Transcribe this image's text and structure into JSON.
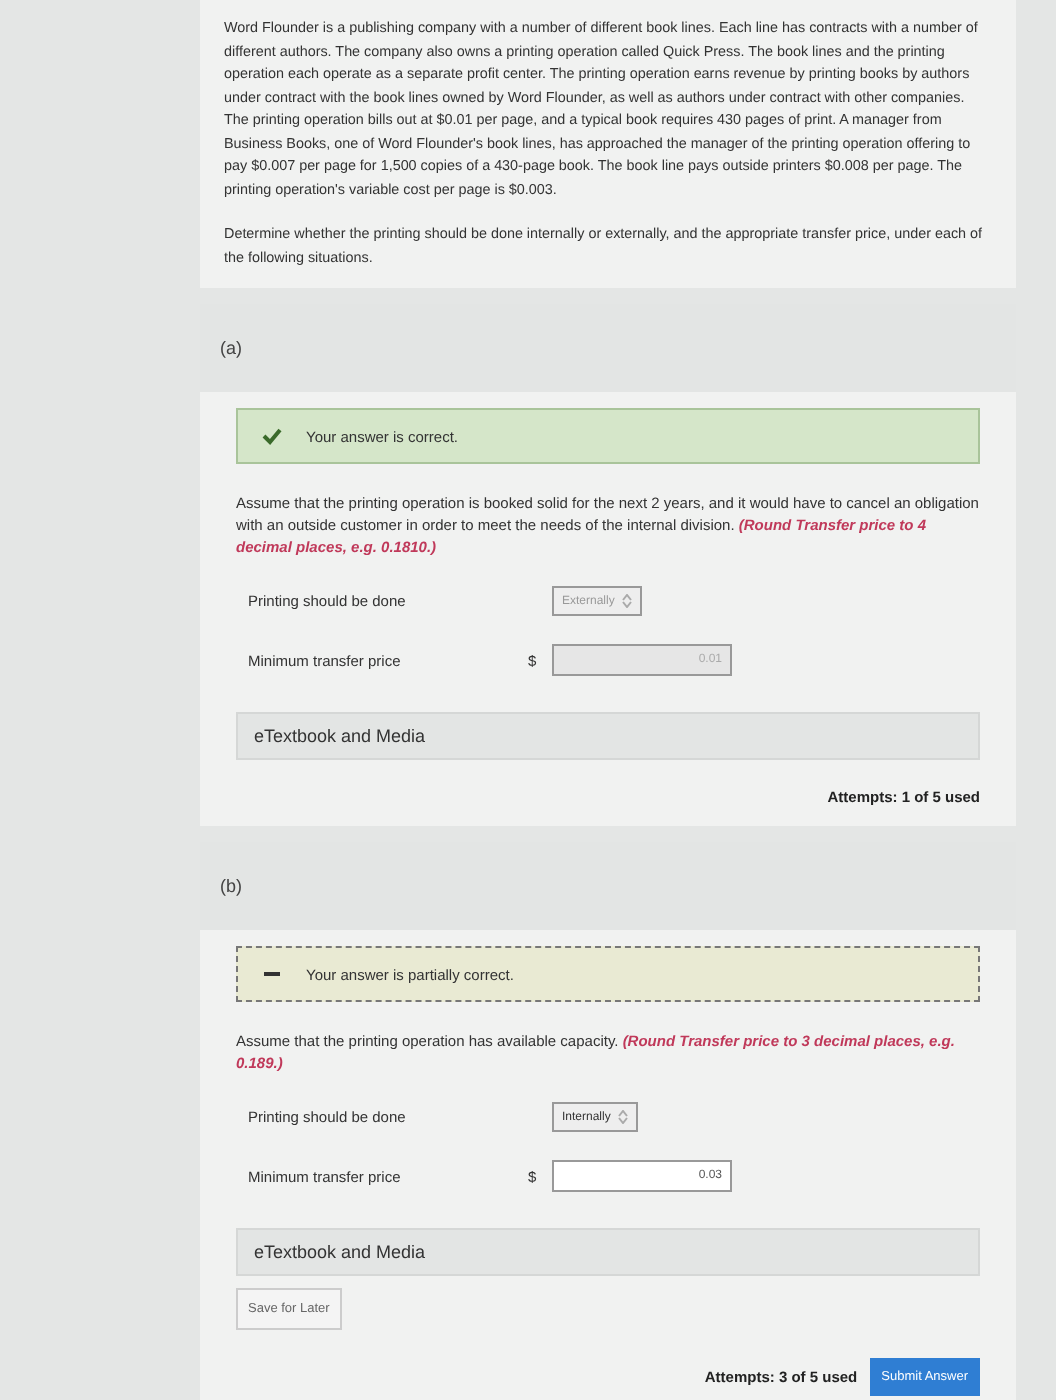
{
  "intro": [
    "Word Flounder is a publishing company with a number of different book lines. Each line has contracts with a number of different authors. The company also owns a printing operation called Quick Press. The book lines and the printing operation each operate as a separate profit center. The printing operation earns revenue by printing books by authors under contract with the book lines owned by Word Flounder, as well as authors under contract with other companies. The printing operation bills out at $0.01 per page, and a typical book requires 430 pages of print. A manager from Business Books, one of Word Flounder's book lines, has approached the manager of the printing operation offering to pay $0.007 per page for 1,500 copies of a 430-page book. The book line pays outside printers $0.008 per page. The printing operation's variable cost per page is $0.003.",
    "Determine whether the printing should be done internally or externally, and the appropriate transfer price, under each of the following situations."
  ],
  "parts": [
    {
      "label": "(a)",
      "disabled": true,
      "feedback": {
        "kind": "correct",
        "text": "Your answer is correct."
      },
      "question": "Assume that the printing operation is booked solid for the next 2 years, and it would have to cancel an obligation with an outside customer in order to meet the needs of the internal division. **(Round Transfer price to 4 decimal places, e.g. 0.1810.)**",
      "printing_label": "Printing should be done",
      "printing_select": "Externally",
      "price_label": "Minimum transfer price",
      "currency": "$",
      "price_value": "0.01",
      "media": "eTextbook and Media",
      "attempts": "Attempts: 1 of 5 used"
    },
    {
      "label": "(b)",
      "disabled": false,
      "feedback": {
        "kind": "partial",
        "text": "Your answer is partially correct."
      },
      "question": "Assume that the printing operation has available capacity. **(Round Transfer price to 3 decimal places, e.g. 0.189.)**",
      "printing_label": "Printing should be done",
      "printing_select": "Internally",
      "price_label": "Minimum transfer price",
      "currency": "$",
      "price_value": "0.03",
      "media": "eTextbook and Media",
      "save_button": "Save for Later",
      "attempts": "Attempts: 3 of 5 used",
      "submit_button": "Submit Answer"
    }
  ]
}
